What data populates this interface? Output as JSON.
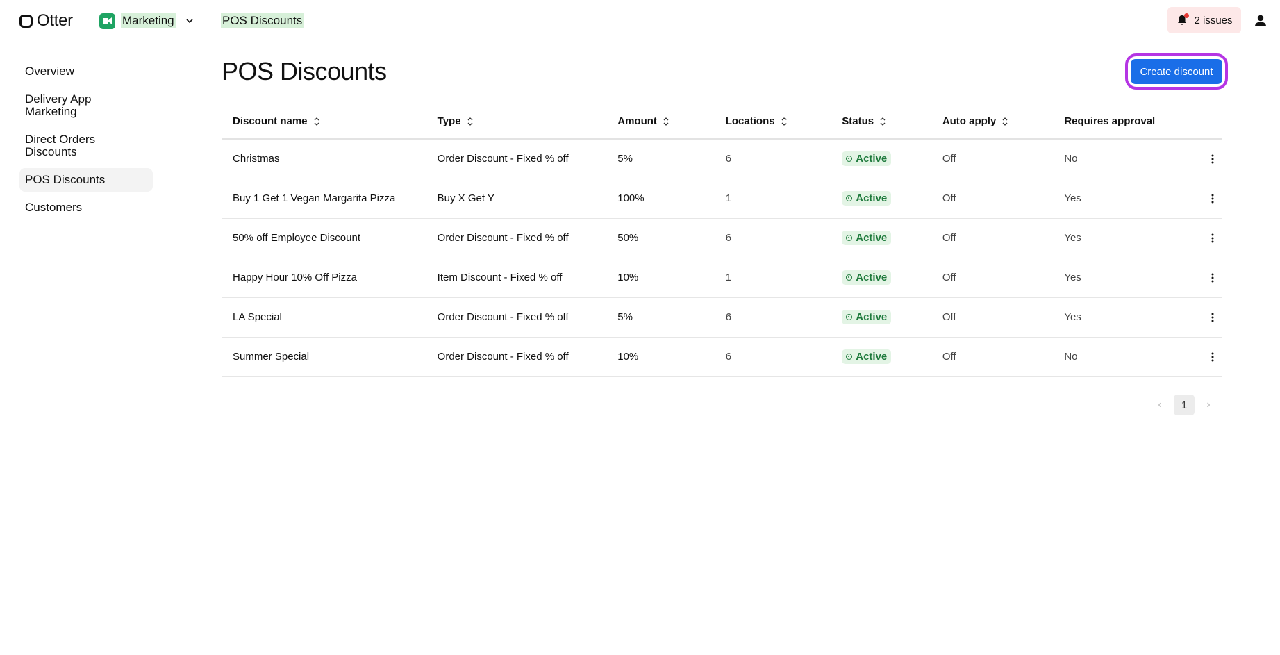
{
  "topbar": {
    "logo_text": "Otter",
    "app_name": "Marketing",
    "breadcrumb": "POS Discounts",
    "issues_label": "2 issues"
  },
  "sidebar": {
    "items": [
      {
        "label": "Overview",
        "active": false
      },
      {
        "label": "Delivery App Marketing",
        "active": false
      },
      {
        "label": "Direct Orders Discounts",
        "active": false
      },
      {
        "label": "POS Discounts",
        "active": true
      },
      {
        "label": "Customers",
        "active": false
      }
    ]
  },
  "main": {
    "title": "POS Discounts",
    "create_button_label": "Create discount",
    "table": {
      "columns": [
        "Discount name",
        "Type",
        "Amount",
        "Locations",
        "Status",
        "Auto apply",
        "Requires approval"
      ],
      "rows": [
        [
          "Christmas",
          "Order Discount - Fixed % off",
          "5%",
          "6",
          "Active",
          "Off",
          "No"
        ],
        [
          "Buy 1 Get 1 Vegan Margarita Pizza",
          "Buy X Get Y",
          "100%",
          "1",
          "Active",
          "Off",
          "Yes"
        ],
        [
          "50% off Employee Discount",
          "Order Discount - Fixed % off",
          "50%",
          "6",
          "Active",
          "Off",
          "Yes"
        ],
        [
          "Happy Hour 10% Off Pizza",
          "Item Discount - Fixed % off",
          "10%",
          "1",
          "Active",
          "Off",
          "Yes"
        ],
        [
          "LA Special",
          "Order Discount - Fixed % off",
          "5%",
          "6",
          "Active",
          "Off",
          "Yes"
        ],
        [
          "Summer Special",
          "Order Discount - Fixed % off",
          "10%",
          "6",
          "Active",
          "Off",
          "No"
        ]
      ]
    },
    "pagination": {
      "current_page": "1",
      "prev_glyph": "‹",
      "next_glyph": "›"
    }
  },
  "colors": {
    "accent": "#1a6ee8",
    "highlight_ring": "#b535e4",
    "status_active_bg": "#e3f4e5",
    "status_active_text": "#1e7a3c",
    "issues_bg": "#fde8e8"
  },
  "icons": [
    "otter-logo-icon",
    "marketing-app-icon",
    "chevron-down-icon",
    "bell-icon",
    "user-icon",
    "sort-icon",
    "kebab-menu-icon",
    "chevron-left-icon",
    "chevron-right-icon"
  ]
}
